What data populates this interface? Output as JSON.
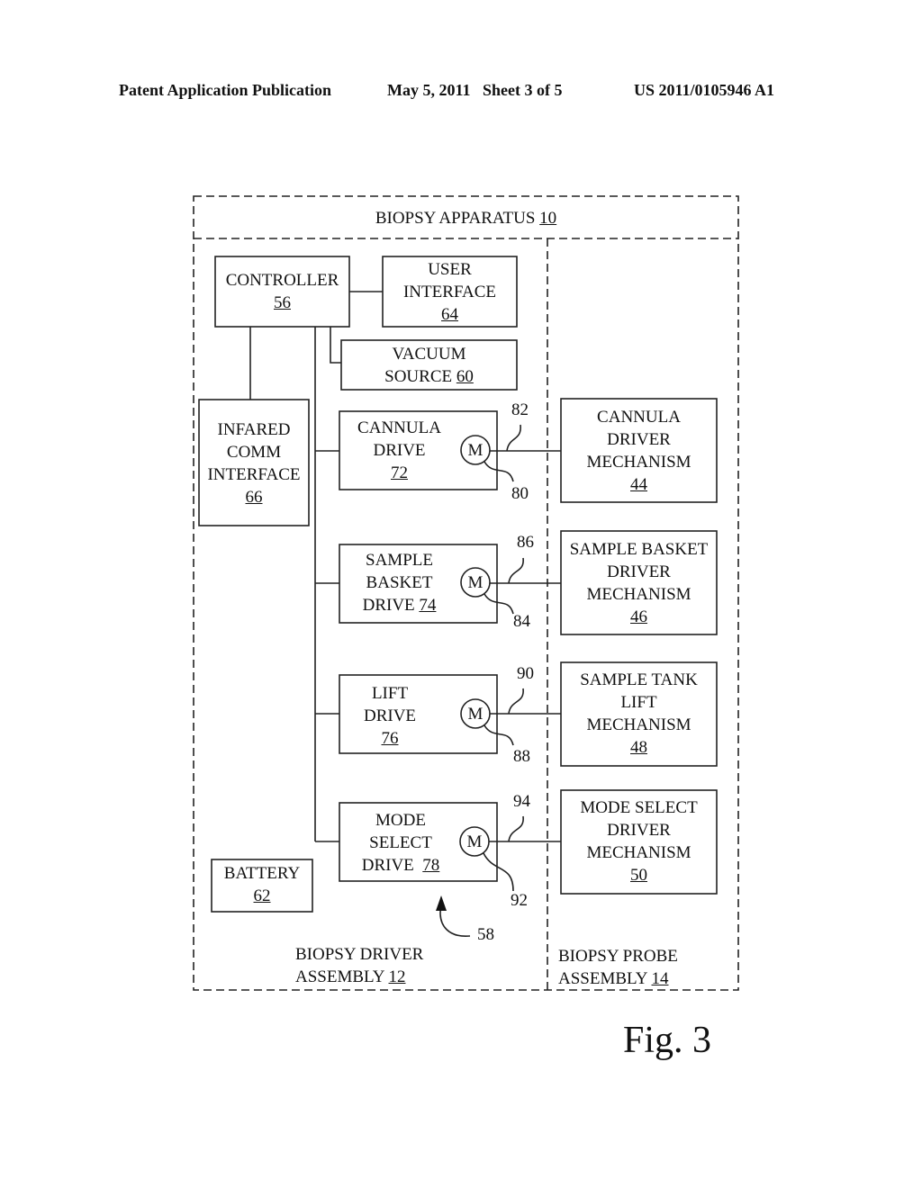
{
  "header": {
    "publication": "Patent Application Publication",
    "date_sheet": "May 5, 2011   Sheet 3 of 5",
    "number": "US 2011/0105946 A1"
  },
  "figure_label": "Fig. 3",
  "diagram": {
    "outer": {
      "text": "BIOPSY APPARATUS",
      "ref": "10"
    },
    "left_region": {
      "line1": "BIOPSY DRIVER",
      "line2": "ASSEMBLY",
      "ref": "12"
    },
    "right_region": {
      "line1": "BIOPSY PROBE",
      "line2": "ASSEMBLY",
      "ref": "14"
    },
    "blocks": {
      "controller": {
        "lines": [
          "CONTROLLER"
        ],
        "ref": "56"
      },
      "user_interface": {
        "lines": [
          "USER",
          "INTERFACE"
        ],
        "ref": "64"
      },
      "vacuum_source": {
        "lines": [
          "VACUUM",
          "SOURCE"
        ],
        "ref": "60"
      },
      "infared_comm": {
        "lines": [
          "INFARED",
          "COMM",
          "INTERFACE"
        ],
        "ref": "66"
      },
      "cannula_drive": {
        "lines": [
          "CANNULA",
          "DRIVE"
        ],
        "ref": "72"
      },
      "sample_basket_drive": {
        "lines": [
          "SAMPLE",
          "BASKET",
          "DRIVE"
        ],
        "ref": "74"
      },
      "lift_drive": {
        "lines": [
          "LIFT",
          "DRIVE"
        ],
        "ref": "76"
      },
      "mode_select_drive": {
        "lines": [
          "MODE",
          "SELECT",
          "DRIVE"
        ],
        "ref": "78"
      },
      "battery": {
        "lines": [
          "BATTERY"
        ],
        "ref": "62"
      },
      "cannula_driver_mech": {
        "lines": [
          "CANNULA",
          "DRIVER",
          "MECHANISM"
        ],
        "ref": "44"
      },
      "sample_basket_driver_mech": {
        "lines": [
          "SAMPLE BASKET",
          "DRIVER",
          "MECHANISM"
        ],
        "ref": "46"
      },
      "sample_tank_lift_mech": {
        "lines": [
          "SAMPLE TANK",
          "LIFT",
          "MECHANISM"
        ],
        "ref": "48"
      },
      "mode_select_driver_mech": {
        "lines": [
          "MODE SELECT",
          "DRIVER",
          "MECHANISM"
        ],
        "ref": "50"
      }
    },
    "motor_symbol": "M",
    "callouts": {
      "r82": "82",
      "r80": "80",
      "r86": "86",
      "r84": "84",
      "r90": "90",
      "r88": "88",
      "r94": "94",
      "r92": "92",
      "r58": "58"
    }
  }
}
